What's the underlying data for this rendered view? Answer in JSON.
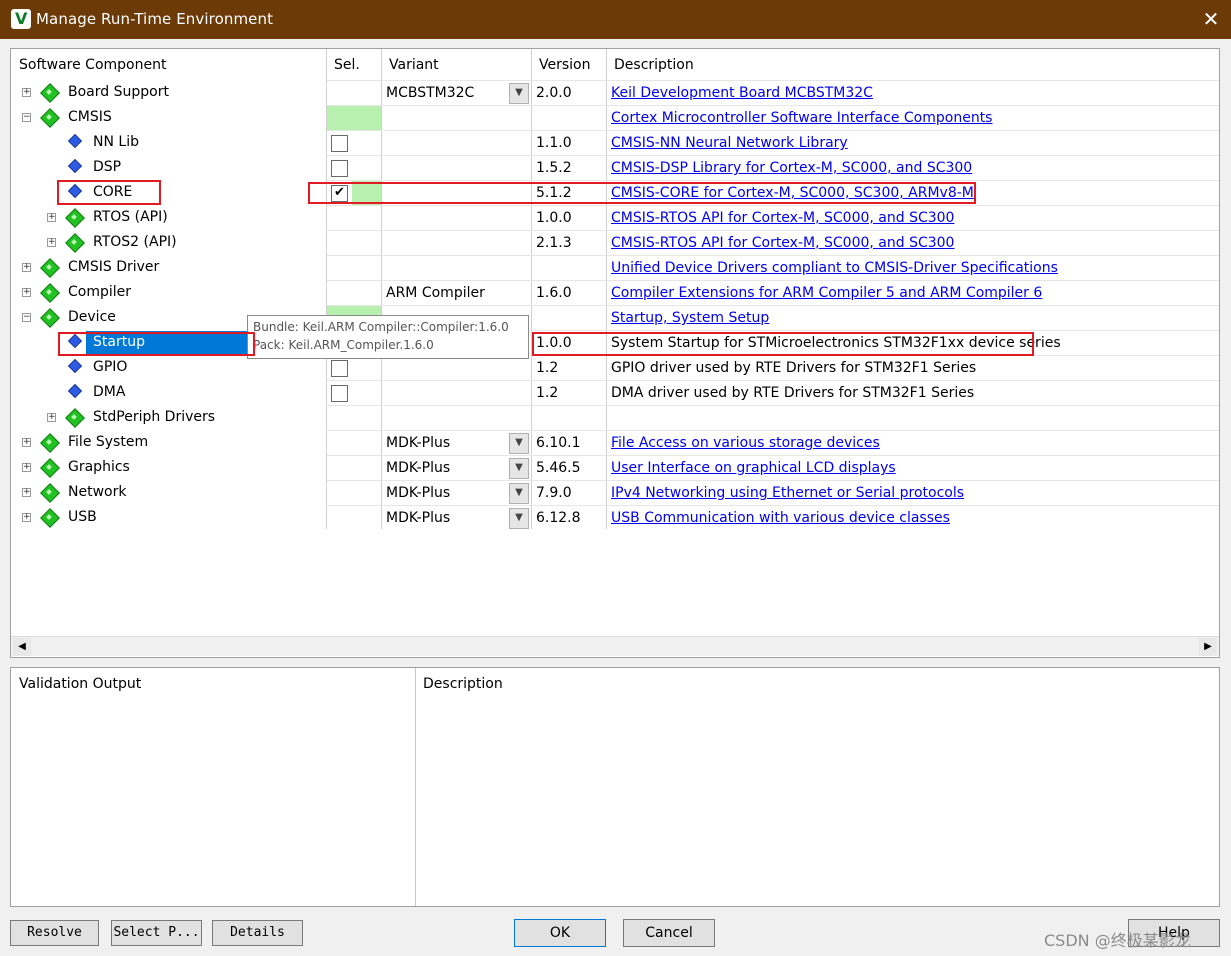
{
  "window": {
    "title": "Manage Run-Time Environment",
    "close_glyph": "✕"
  },
  "columns": {
    "component": "Software Component",
    "sel": "Sel.",
    "variant": "Variant",
    "version": "Version",
    "description": "Description"
  },
  "rows": [
    {
      "name": "Board Support",
      "variant": "MCBSTM32C",
      "version": "2.0.0",
      "description": "Keil Development Board MCBSTM32C"
    },
    {
      "name": "CMSIS",
      "variant": "",
      "version": "",
      "description": "Cortex Microcontroller Software Interface Components"
    },
    {
      "name": "NN Lib",
      "variant": "",
      "version": "1.1.0",
      "description": "CMSIS-NN Neural Network Library"
    },
    {
      "name": "DSP",
      "variant": "",
      "version": "1.5.2",
      "description": "CMSIS-DSP Library for Cortex-M, SC000, and SC300"
    },
    {
      "name": "CORE",
      "variant": "",
      "version": "5.1.2",
      "description": "CMSIS-CORE for Cortex-M, SC000, SC300, ARMv8-M"
    },
    {
      "name": "RTOS (API)",
      "variant": "",
      "version": "1.0.0",
      "description": "CMSIS-RTOS API for Cortex-M, SC000, and SC300"
    },
    {
      "name": "RTOS2 (API)",
      "variant": "",
      "version": "2.1.3",
      "description": "CMSIS-RTOS API for Cortex-M, SC000, and SC300"
    },
    {
      "name": "CMSIS Driver",
      "variant": "",
      "version": "",
      "description": "Unified Device Drivers compliant to CMSIS-Driver Specifications"
    },
    {
      "name": "Compiler",
      "variant": "ARM Compiler",
      "version": "1.6.0",
      "description": "Compiler Extensions for ARM Compiler 5 and ARM Compiler 6"
    },
    {
      "name": "Device",
      "variant": "",
      "version": "",
      "description": "Startup, System Setup"
    },
    {
      "name": "Startup",
      "variant": "",
      "version": "1.0.0",
      "description": "System Startup for STMicroelectronics STM32F1xx device series"
    },
    {
      "name": "GPIO",
      "variant": "",
      "version": "1.2",
      "description": "GPIO driver used by RTE Drivers for STM32F1 Series"
    },
    {
      "name": "DMA",
      "variant": "",
      "version": "1.2",
      "description": "DMA driver used by RTE Drivers for STM32F1 Series"
    },
    {
      "name": "StdPeriph Drivers",
      "variant": "",
      "version": "",
      "description": ""
    },
    {
      "name": "File System",
      "variant": "MDK-Plus",
      "version": "6.10.1",
      "description": "File Access on various storage devices"
    },
    {
      "name": "Graphics",
      "variant": "MDK-Plus",
      "version": "5.46.5",
      "description": "User Interface on graphical LCD displays"
    },
    {
      "name": "Network",
      "variant": "MDK-Plus",
      "version": "7.9.0",
      "description": "IPv4 Networking using Ethernet or Serial protocols"
    },
    {
      "name": "USB",
      "variant": "MDK-Plus",
      "version": "6.12.8",
      "description": "USB Communication with various device classes"
    }
  ],
  "tooltip": {
    "line1": "Bundle: Keil.ARM Compiler::Compiler:1.6.0",
    "line2": "Pack: Keil.ARM_Compiler.1.6.0"
  },
  "validation": {
    "output_header": "Validation Output",
    "description_header": "Description"
  },
  "buttons": {
    "resolve": "Resolve",
    "select_packs": "Select P...",
    "details": "Details",
    "ok": "OK",
    "cancel": "Cancel",
    "help": "Help"
  },
  "watermark": "CSDN @终极某影龙",
  "colors": {
    "titlebar": "#6b3a07",
    "selection": "#0078d7",
    "highlight_red": "#e01b24",
    "selectable_green": "#b8f0b0",
    "link": "#0000ee"
  }
}
